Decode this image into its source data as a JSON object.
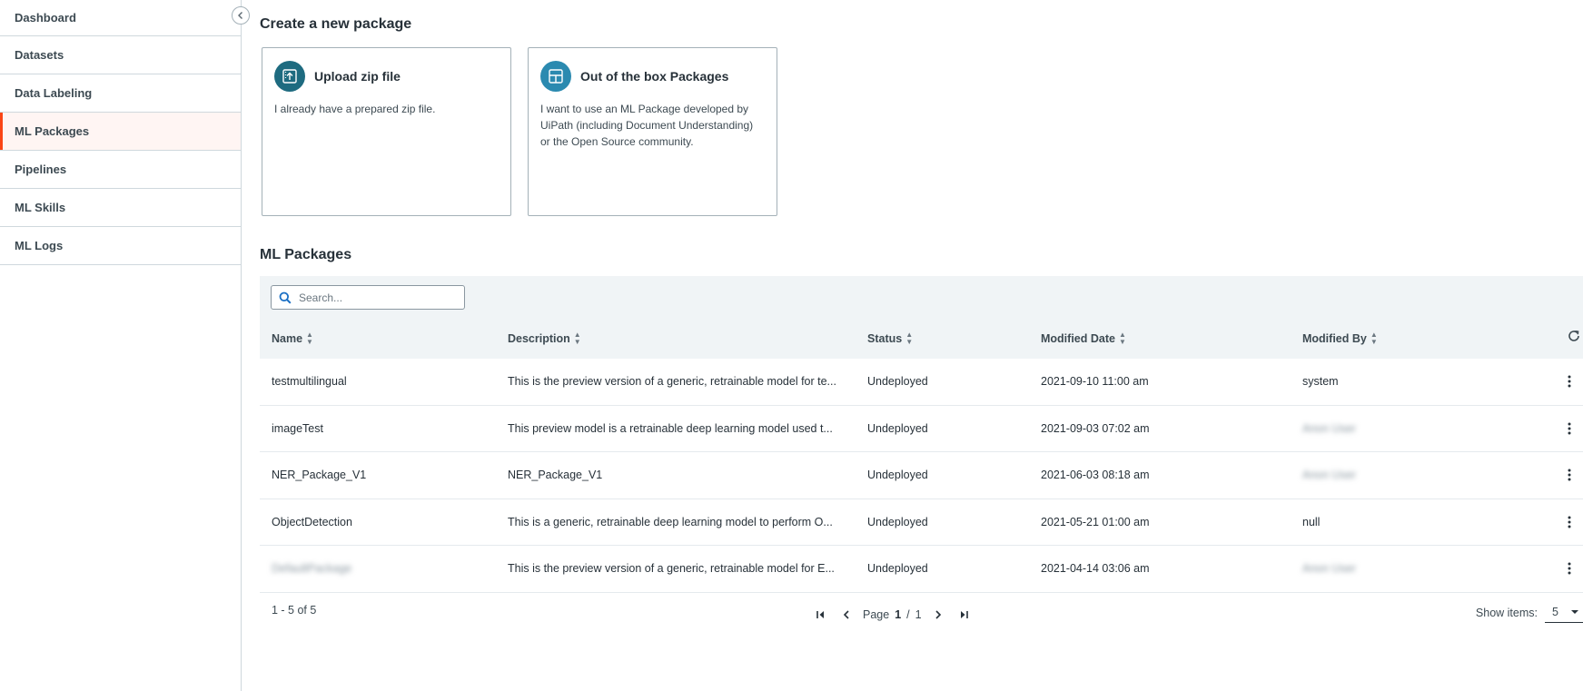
{
  "sidebar": {
    "items": [
      {
        "label": "Dashboard"
      },
      {
        "label": "Datasets"
      },
      {
        "label": "Data Labeling"
      },
      {
        "label": "ML Packages"
      },
      {
        "label": "Pipelines"
      },
      {
        "label": "ML Skills"
      },
      {
        "label": "ML Logs"
      }
    ],
    "active_item": "ML Packages"
  },
  "create": {
    "title": "Create a new package",
    "cards": [
      {
        "title": "Upload zip file",
        "description": "I already have a prepared zip file.",
        "icon": "upload-zip-icon",
        "icon_color": "#1e6b80"
      },
      {
        "title": "Out of the box Packages",
        "description": "I want to use an ML Package developed by UiPath (including Document Understanding) or the Open Source community.",
        "icon": "package-layout-icon",
        "icon_color": "#2b8ab0"
      }
    ]
  },
  "packages": {
    "title": "ML Packages",
    "search_placeholder": "Search...",
    "columns": {
      "name": "Name",
      "description": "Description",
      "status": "Status",
      "modified_date": "Modified Date",
      "modified_by": "Modified By"
    },
    "rows": [
      {
        "name": "testmultilingual",
        "description": "This is the preview version of a generic, retrainable model for te...",
        "status": "Undeployed",
        "modified_date": "2021-09-10 11:00 am",
        "modified_by": "system"
      },
      {
        "name": "imageTest",
        "description": "This preview model is a retrainable deep learning model used t...",
        "status": "Undeployed",
        "modified_date": "2021-09-03 07:02 am",
        "modified_by": "Anon User"
      },
      {
        "name": "NER_Package_V1",
        "description": "NER_Package_V1",
        "status": "Undeployed",
        "modified_date": "2021-06-03 08:18 am",
        "modified_by": "Anon User"
      },
      {
        "name": "ObjectDetection",
        "description": "This is a generic, retrainable deep learning model to perform O...",
        "status": "Undeployed",
        "modified_date": "2021-05-21 01:00 am",
        "modified_by": "null"
      },
      {
        "name": "DefaultPackage",
        "description": "This is the preview version of a generic, retrainable model for E...",
        "status": "Undeployed",
        "modified_date": "2021-04-14 03:06 am",
        "modified_by": "Anon User"
      }
    ],
    "footer": {
      "range": "1 - 5 of 5",
      "page_word": "Page",
      "current_page": "1",
      "separator": "/",
      "total_pages": "1",
      "show_items_label": "Show items:",
      "page_size": "5"
    }
  },
  "colors": {
    "accent": "#fa4616",
    "toolbar_bg": "#f0f4f6",
    "border": "#cfd8dd"
  }
}
